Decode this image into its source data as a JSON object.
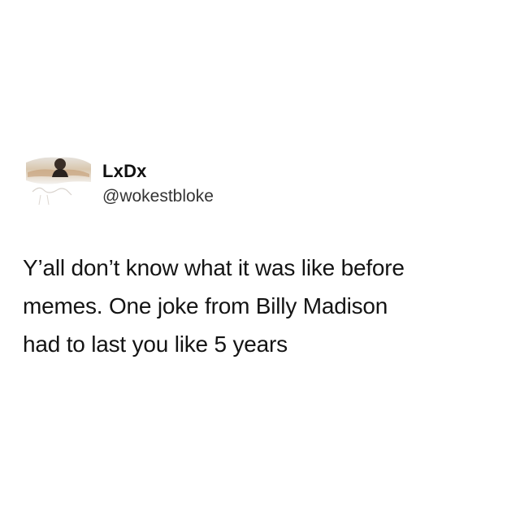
{
  "tweet": {
    "author": {
      "display_name": "LxDx",
      "handle": "@wokestbloke",
      "avatar_icon": "user-avatar-photo"
    },
    "text_lines": [
      "Y’all don’t know what it was like before",
      "memes. One joke from Billy Madison",
      "had to last you like 5 years"
    ]
  },
  "colors": {
    "background": "#ffffff",
    "text": "#141414"
  }
}
